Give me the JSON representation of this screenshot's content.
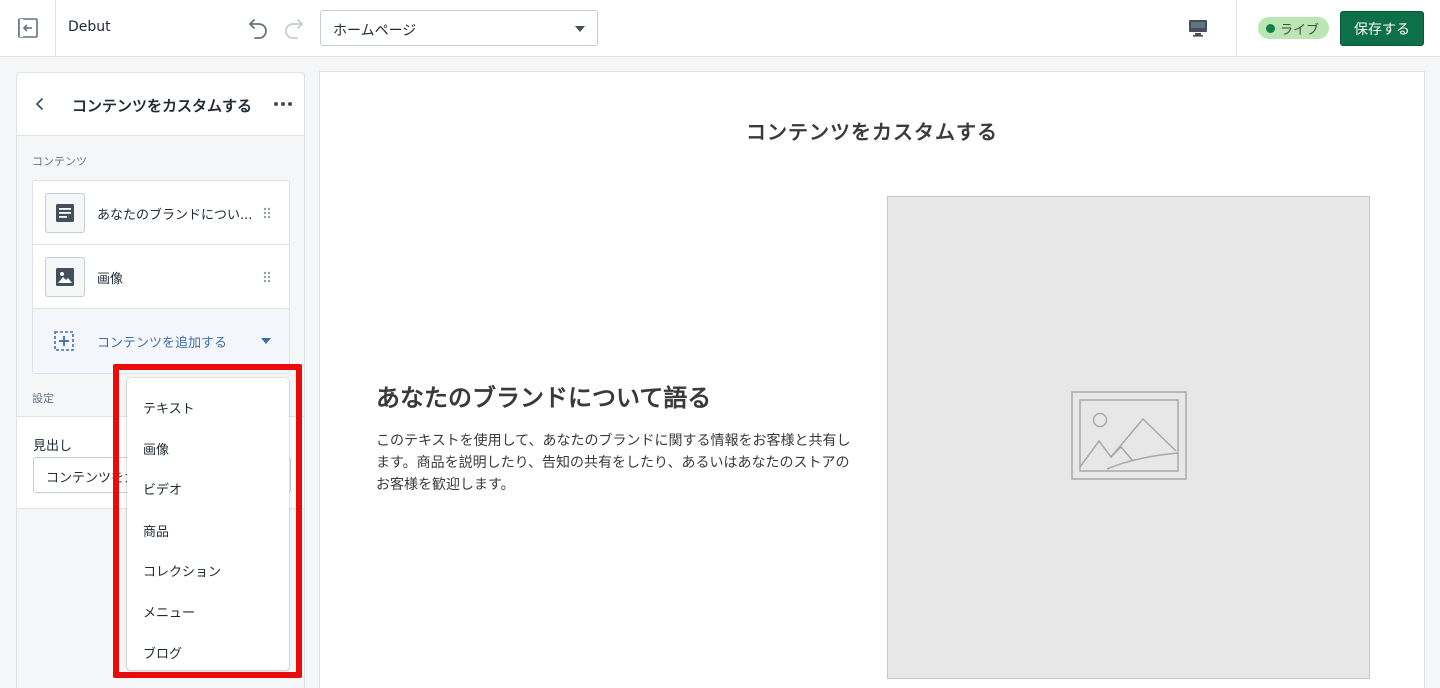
{
  "topbar": {
    "theme_name": "Debut",
    "page_select_value": "ホームページ",
    "live_label": "ライブ",
    "save_label": "保存する"
  },
  "sidebar": {
    "title": "コンテンツをカスタムする",
    "content_section_label": "コンテンツ",
    "blocks": [
      {
        "label": "あなたのブランドについ...",
        "icon": "text-block-icon"
      },
      {
        "label": "画像",
        "icon": "image-block-icon"
      }
    ],
    "add_content_label": "コンテンツを追加する",
    "settings_section_label": "設定",
    "heading_field_label": "見出し",
    "heading_field_value": "コンテンツをカスタムする"
  },
  "dropdown": {
    "items": [
      "テキスト",
      "画像",
      "ビデオ",
      "商品",
      "コレクション",
      "メニュー",
      "ブログ"
    ]
  },
  "preview": {
    "heading": "コンテンツをカスタムする",
    "subheading": "あなたのブランドについて語る",
    "text": "このテキストを使用して、あなたのブランドに関する情報をお客様と共有します。商品を説明したり、告知の共有をしたり、あるいはあなたのストアのお客様を歓迎します。"
  },
  "colors": {
    "save_button": "#0d7048",
    "live_badge": "#bbe5b3",
    "highlight": "#ea0b0b",
    "add_content": "#3e6ea9"
  }
}
